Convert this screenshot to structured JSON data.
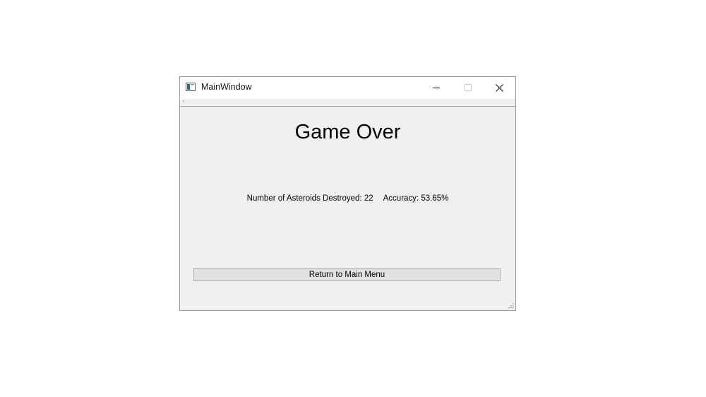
{
  "window": {
    "title": "MainWindow",
    "controls": {
      "minimize_icon": "minimize-icon",
      "maximize_icon": "maximize-icon",
      "close_icon": "close-icon"
    }
  },
  "main": {
    "heading": "Game Over",
    "stats": {
      "asteroids_label": "Number of Asteroids Destroyed: 22",
      "accuracy_label": "Accuracy: 53.65%"
    },
    "return_button_label": "Return to Main Menu"
  },
  "colors": {
    "window_bg": "#f0f0f0",
    "titlebar_bg": "#ffffff",
    "button_bg": "#e1e1e1",
    "button_border": "#adadad"
  }
}
